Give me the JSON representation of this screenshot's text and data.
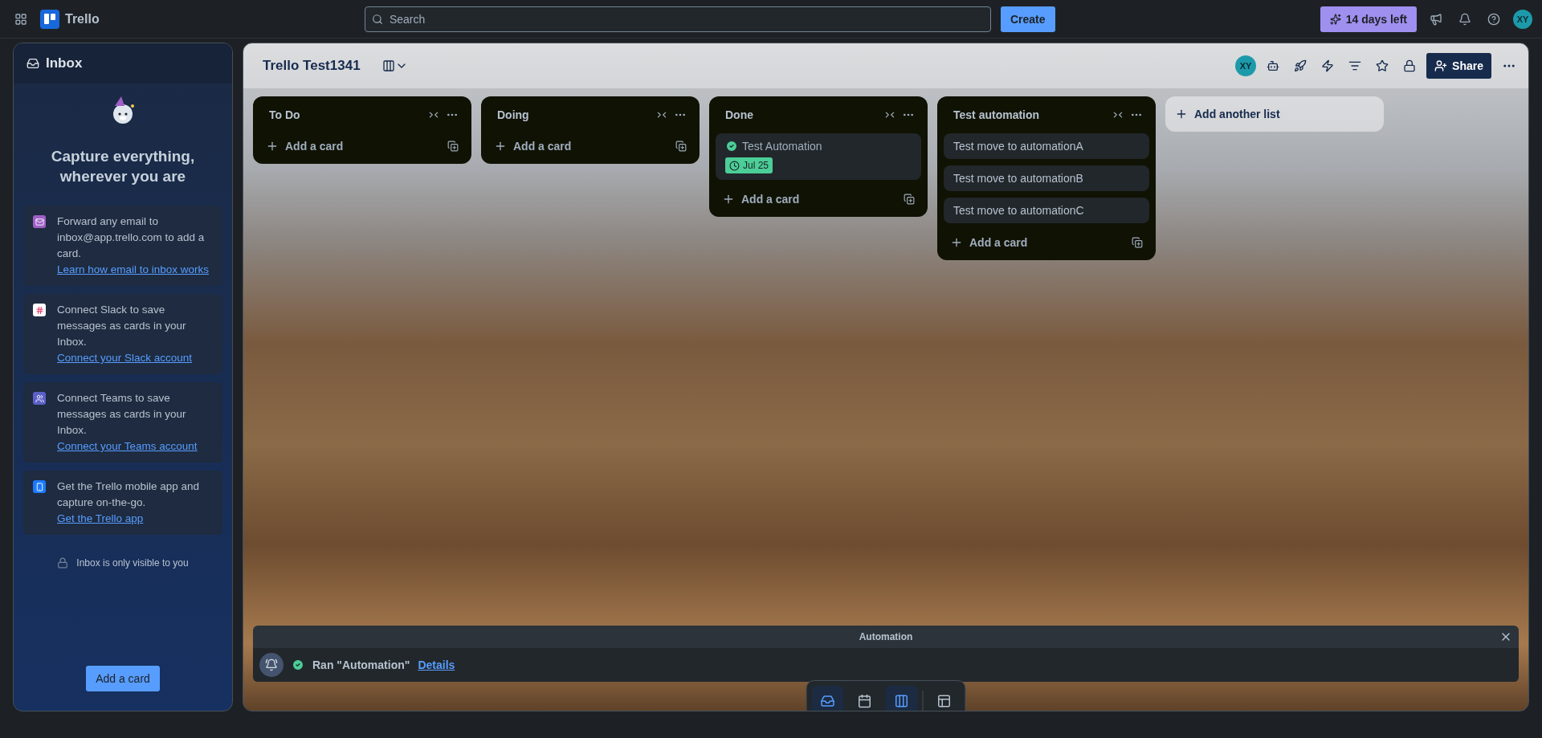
{
  "topbar": {
    "app_name": "Trello",
    "search": {
      "placeholder": "Search"
    },
    "create_button": "Create",
    "trial_badge": "14 days left",
    "avatar": "XY"
  },
  "inbox": {
    "title": "Inbox",
    "headline": "Capture everything, wherever you are",
    "tips": [
      {
        "kind": "email",
        "text": "Forward any email to inbox@app.trello.com to add a card.",
        "link": "Learn how email to inbox works"
      },
      {
        "kind": "slack",
        "text": "Connect Slack to save messages as cards in your Inbox.",
        "link": "Connect your Slack account"
      },
      {
        "kind": "teams",
        "text": "Connect Teams to save messages as cards in your Inbox.",
        "link": "Connect your Teams account"
      },
      {
        "kind": "mobile",
        "text": "Get the Trello mobile app and capture on-the-go.",
        "link": "Get the Trello app"
      }
    ],
    "privacy_note": "Inbox is only visible to you",
    "add_button": "Add a card"
  },
  "board": {
    "title": "Trello Test1341",
    "member_avatar": "XY",
    "share_button": "Share",
    "lists": [
      {
        "title": "To Do",
        "add_label": "Add a card"
      },
      {
        "title": "Doing",
        "add_label": "Add a card"
      },
      {
        "title": "Done",
        "cards": [
          {
            "title": "Test Automation",
            "complete": true,
            "due": "Jul 25"
          }
        ],
        "add_label": "Add a card"
      },
      {
        "title": "Test automation",
        "cards": [
          {
            "title": "Test move to automationA",
            "complete": false
          },
          {
            "title": "Test move to automationB",
            "complete": false
          },
          {
            "title": "Test move to automationC",
            "complete": false
          }
        ],
        "add_label": "Add a card"
      }
    ],
    "add_list": "Add another list"
  },
  "toast": {
    "title": "Automation",
    "message": "Ran \"Automation\"",
    "link": "Details"
  },
  "bottom_nav": [
    {
      "kind": "inbox",
      "selected": true
    },
    {
      "kind": "planner",
      "selected": false
    },
    {
      "kind": "board",
      "selected": true
    },
    {
      "kind": "switch",
      "selected": false
    }
  ]
}
